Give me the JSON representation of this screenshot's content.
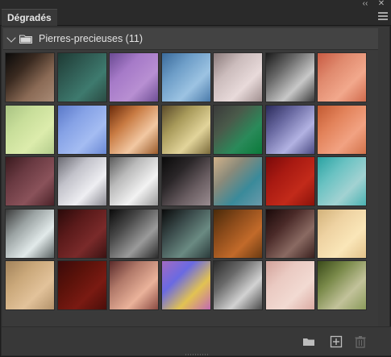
{
  "panel": {
    "tab_title": "Dégradés",
    "group_name": "Pierres-precieuses (11)"
  },
  "icons": {
    "collapse": "double-chevron-left-icon",
    "close": "close-icon",
    "menu": "hamburger-menu-icon",
    "group_toggle": "chevron-down-icon",
    "group_folder": "folder-icon",
    "new_group": "folder-icon",
    "new_gradient": "add-icon",
    "delete": "trash-icon"
  },
  "swatch_rows": [
    [
      {
        "angle": 135,
        "stops": [
          "#0a0a0a",
          "#3a2a20",
          "#8a6a55",
          "#a88a75"
        ]
      },
      {
        "angle": 135,
        "stops": [
          "#1e3a34",
          "#2f5a52",
          "#3e7a6e",
          "#2a4a42"
        ]
      },
      {
        "angle": 135,
        "stops": [
          "#6a4a92",
          "#a67ac8",
          "#b88fd2",
          "#6e4f95"
        ]
      },
      {
        "angle": 135,
        "stops": [
          "#3a6a9a",
          "#6e9ec8",
          "#9cc3e2",
          "#4a7aaa"
        ]
      },
      {
        "angle": 135,
        "stops": [
          "#8a7a7a",
          "#cbbcbc",
          "#e8dada",
          "#a08f8f"
        ]
      },
      {
        "angle": 135,
        "stops": [
          "#1a1a1a",
          "#6a6a6a",
          "#c8c8c8",
          "#3a3a3a"
        ]
      },
      {
        "angle": 135,
        "stops": [
          "#c85a42",
          "#e08a6e",
          "#f2a88c",
          "#d06a4c"
        ]
      }
    ],
    [
      {
        "angle": 135,
        "stops": [
          "#a8c282",
          "#c8de9a",
          "#dcecac",
          "#b4cc8c"
        ]
      },
      {
        "angle": 135,
        "stops": [
          "#5a78c8",
          "#86a2e6",
          "#a4bcf2",
          "#6a88d4"
        ]
      },
      {
        "angle": 135,
        "stops": [
          "#6a2a0a",
          "#c87a42",
          "#f2c8a2",
          "#9a5a2a"
        ]
      },
      {
        "angle": 135,
        "stops": [
          "#5a4a2a",
          "#a89a5a",
          "#e2d49a",
          "#7a6a3a"
        ]
      },
      {
        "angle": 135,
        "stops": [
          "#3a3a3a",
          "#4a5a4a",
          "#2a8a5a",
          "#0a7a3a"
        ]
      },
      {
        "angle": 135,
        "stops": [
          "#2a2a5a",
          "#6a6aa2",
          "#b2b2e2",
          "#4a4a82"
        ]
      },
      {
        "angle": 135,
        "stops": [
          "#c25a32",
          "#e2825a",
          "#f2a282",
          "#d2724a"
        ]
      }
    ],
    [
      {
        "angle": 135,
        "stops": [
          "#3a1a1e",
          "#6a3a42",
          "#8a525a",
          "#4a2228"
        ]
      },
      {
        "angle": 135,
        "stops": [
          "#6a6a72",
          "#c2c2ca",
          "#eeeef2",
          "#8a8a92"
        ]
      },
      {
        "angle": 135,
        "stops": [
          "#5a5a5a",
          "#bababa",
          "#f2f2f2",
          "#9a9a9a"
        ]
      },
      {
        "angle": 135,
        "stops": [
          "#0a0a0a",
          "#2a2628",
          "#6a5e62",
          "#9a8c90"
        ]
      },
      {
        "angle": 135,
        "stops": [
          "#d2b28a",
          "#8a8a7a",
          "#3a8a9a",
          "#6a9aaa"
        ]
      },
      {
        "angle": 135,
        "stops": [
          "#7a0a0a",
          "#a81a12",
          "#c22a1a",
          "#8a120a"
        ]
      },
      {
        "angle": 135,
        "stops": [
          "#2aa2a2",
          "#6ac2c2",
          "#a2d2d2",
          "#4ab2b2"
        ]
      }
    ],
    [
      {
        "angle": 135,
        "stops": [
          "#3a3a3a",
          "#9aa2a2",
          "#e2eaea",
          "#5a6262"
        ]
      },
      {
        "angle": 135,
        "stops": [
          "#2a0a0a",
          "#5a1a1a",
          "#7a2a2a",
          "#3a1212"
        ]
      },
      {
        "angle": 135,
        "stops": [
          "#0a0a0a",
          "#4a4a4a",
          "#9a9a9a",
          "#2a2a2a"
        ]
      },
      {
        "angle": 135,
        "stops": [
          "#0a0a0a",
          "#3a4a4a",
          "#6a8a82",
          "#2a3a3a"
        ]
      },
      {
        "angle": 135,
        "stops": [
          "#4a2a0a",
          "#8a4a1a",
          "#c26a2a",
          "#6a3a12"
        ]
      },
      {
        "angle": 135,
        "stops": [
          "#1a0a0a",
          "#4a2a28",
          "#8a6a62",
          "#3a201e"
        ]
      },
      {
        "angle": 135,
        "stops": [
          "#d2b27a",
          "#eed2a2",
          "#fae6b8",
          "#e2c28a"
        ]
      }
    ],
    [
      {
        "angle": 135,
        "stops": [
          "#a2825a",
          "#caa87a",
          "#e2c29a",
          "#b2926a"
        ]
      },
      {
        "angle": 135,
        "stops": [
          "#3a0a0a",
          "#5a120a",
          "#7a1a12",
          "#4a0e0a"
        ]
      },
      {
        "angle": 135,
        "stops": [
          "#5a2a2a",
          "#b27a6a",
          "#eab29a",
          "#8a4a42"
        ]
      },
      {
        "angle": 135,
        "stops": [
          "#a26ac2",
          "#6a6ae2",
          "#e2c252",
          "#c26ab2"
        ]
      },
      {
        "angle": 135,
        "stops": [
          "#2a2a2a",
          "#6a6a6a",
          "#d2d2d2",
          "#4a4a4a"
        ]
      },
      {
        "angle": 135,
        "stops": [
          "#d2a29a",
          "#eacac2",
          "#f2dad2",
          "#daaaa2"
        ]
      },
      {
        "angle": 135,
        "stops": [
          "#3a4a1a",
          "#7a8a4a",
          "#c2c29a",
          "#8a9a5a"
        ]
      }
    ]
  ]
}
